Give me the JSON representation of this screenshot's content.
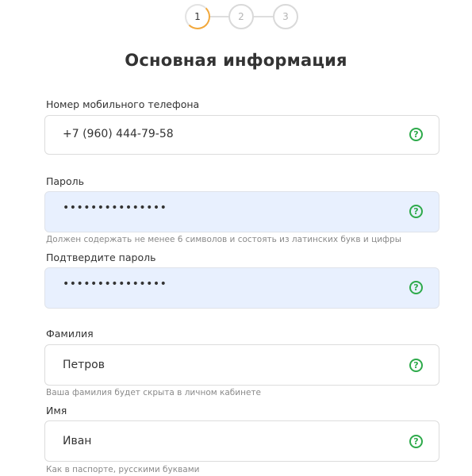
{
  "stepper": {
    "steps": [
      {
        "label": "1",
        "state": "active"
      },
      {
        "label": "2",
        "state": "inactive"
      },
      {
        "label": "3",
        "state": "inactive"
      }
    ]
  },
  "page_title": "Основная информация",
  "fields": {
    "phone": {
      "label": "Номер мобильного телефона",
      "value": "+7 (960) 444-79-58",
      "help_icon": "?"
    },
    "password": {
      "label": "Пароль",
      "value": "•••••••••••••••",
      "hint": "Должен содержать не менее 6 символов и состоять из латинских букв и цифры",
      "help_icon": "?"
    },
    "password_confirm": {
      "label": "Подтвердите пароль",
      "value": "•••••••••••••••",
      "help_icon": "?"
    },
    "last_name": {
      "label": "Фамилия",
      "value": "Петров",
      "hint": "Ваша фамилия будет скрыта в личном кабинете",
      "help_icon": "?"
    },
    "first_name": {
      "label": "Имя",
      "value": "Иван",
      "hint": "Как в паспорте, русскими буквами",
      "help_icon": "?"
    }
  },
  "colors": {
    "accent": "#f2a83b",
    "help_icon": "#2eaa4b",
    "autofill_background": "#e8f0fe"
  },
  "icons": {
    "help": "question-circle-icon"
  }
}
